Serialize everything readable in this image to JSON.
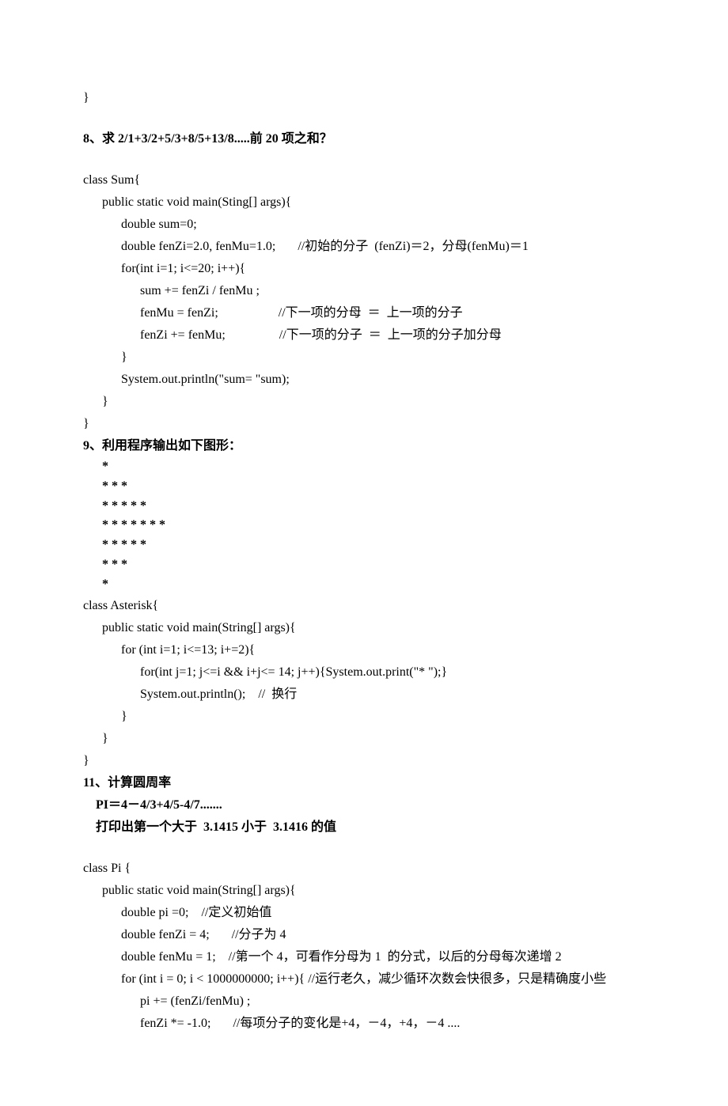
{
  "lines": [
    {
      "text": "}",
      "bold": false,
      "tight": false
    },
    {
      "spacer": true
    },
    {
      "text": "8、求 2/1+3/2+5/3+8/5+13/8.....前 20 项之和？",
      "bold": true,
      "tight": false
    },
    {
      "spacer": true
    },
    {
      "text": "class Sum{",
      "bold": false,
      "tight": false
    },
    {
      "text": "      public static void main(Sting[] args){",
      "bold": false,
      "tight": false
    },
    {
      "text": "            double sum=0;",
      "bold": false,
      "tight": false
    },
    {
      "text": "            double fenZi=2.0, fenMu=1.0;       //初始的分子  (fenZi)＝2，分母(fenMu)＝1",
      "bold": false,
      "tight": false
    },
    {
      "text": "            for(int i=1; i<=20; i++){",
      "bold": false,
      "tight": false
    },
    {
      "text": "                  sum += fenZi / fenMu ;",
      "bold": false,
      "tight": false
    },
    {
      "text": "                  fenMu = fenZi;                   //下一项的分母  ＝  上一项的分子",
      "bold": false,
      "tight": false
    },
    {
      "text": "                  fenZi += fenMu;                 //下一项的分子  ＝  上一项的分子加分母",
      "bold": false,
      "tight": false
    },
    {
      "text": "            }",
      "bold": false,
      "tight": false
    },
    {
      "text": "            System.out.println(\"sum= \"sum);",
      "bold": false,
      "tight": false
    },
    {
      "text": "      }",
      "bold": false,
      "tight": false
    },
    {
      "text": "}",
      "bold": false,
      "tight": false
    },
    {
      "text": "9、利用程序输出如下图形：",
      "bold": true,
      "tight": false
    },
    {
      "text": "      *",
      "bold": true,
      "tight": true
    },
    {
      "text": "      * * *",
      "bold": true,
      "tight": true
    },
    {
      "text": "      * * * * *",
      "bold": true,
      "tight": true
    },
    {
      "text": "      * * * * * * *",
      "bold": true,
      "tight": true
    },
    {
      "text": "      * * * * *",
      "bold": true,
      "tight": true
    },
    {
      "text": "      * * *",
      "bold": true,
      "tight": true
    },
    {
      "text": "      *",
      "bold": true,
      "tight": true
    },
    {
      "text": "class Asterisk{",
      "bold": false,
      "tight": false
    },
    {
      "text": "      public static void main(String[] args){",
      "bold": false,
      "tight": false
    },
    {
      "text": "            for (int i=1; i<=13; i+=2){",
      "bold": false,
      "tight": false
    },
    {
      "text": "                  for(int j=1; j<=i && i+j<= 14; j++){System.out.print(\"* \");}",
      "bold": false,
      "tight": false
    },
    {
      "text": "                  System.out.println();    //  换行",
      "bold": false,
      "tight": false
    },
    {
      "text": "            }",
      "bold": false,
      "tight": false
    },
    {
      "text": "      }",
      "bold": false,
      "tight": false
    },
    {
      "text": "}",
      "bold": false,
      "tight": false
    },
    {
      "text": "11、计算圆周率",
      "bold": true,
      "tight": false
    },
    {
      "text": "    PI＝4－4/3+4/5-4/7.......",
      "bold": true,
      "tight": false
    },
    {
      "text": "    打印出第一个大于  3.1415 小于  3.1416 的值",
      "bold": true,
      "tight": false
    },
    {
      "spacer": true
    },
    {
      "text": "class Pi {",
      "bold": false,
      "tight": false
    },
    {
      "text": "      public static void main(String[] args){",
      "bold": false,
      "tight": false
    },
    {
      "text": "            double pi =0;    //定义初始值",
      "bold": false,
      "tight": false
    },
    {
      "text": "            double fenZi = 4;       //分子为 4",
      "bold": false,
      "tight": false
    },
    {
      "text": "            double fenMu = 1;    //第一个 4，可看作分母为 1  的分式，以后的分母每次递增 2",
      "bold": false,
      "tight": false
    },
    {
      "text": "            for (int i = 0; i < 1000000000; i++){ //运行老久，减少循环次数会快很多，只是精确度小些",
      "bold": false,
      "tight": false
    },
    {
      "text": "                  pi += (fenZi/fenMu) ;",
      "bold": false,
      "tight": false
    },
    {
      "text": "                  fenZi *= -1.0;       //每项分子的变化是+4，－4，+4，－4 ....",
      "bold": false,
      "tight": false
    }
  ]
}
